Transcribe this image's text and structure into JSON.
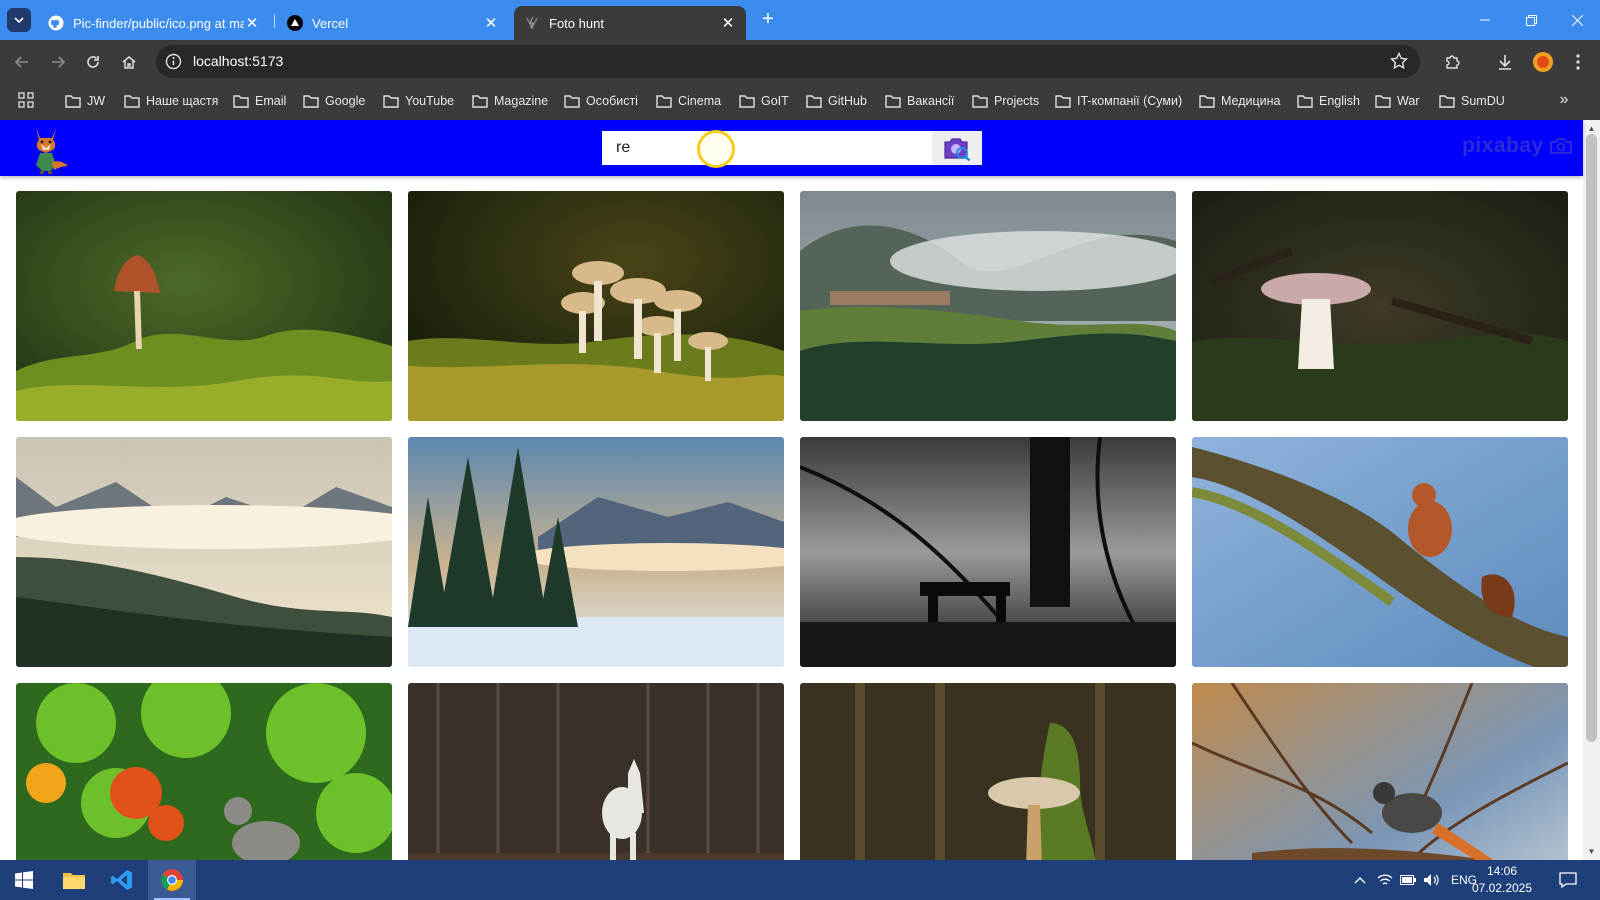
{
  "browser": {
    "tabs": [
      {
        "title": "Pic-finder/public/ico.png at ma",
        "icon": "github-icon",
        "close": "✕"
      },
      {
        "title": "Vercel",
        "icon": "vercel-icon",
        "close": "✕"
      },
      {
        "title": "Foto hunt",
        "icon": "vite-icon",
        "close": "✕",
        "active": true
      }
    ],
    "new_tab": "+",
    "url": "localhost:5173",
    "bookmarks": [
      "JW",
      "Наше щастя",
      "Email",
      "Google",
      "YouTube",
      "Magazine",
      "Особисті",
      "Cinema",
      "GoIT",
      "GitHub",
      "Вакансії",
      "Projects",
      "IT-компанії (Суми)",
      "Медицина",
      "English",
      "War",
      "SumDU"
    ],
    "more_bookmarks": "»"
  },
  "app": {
    "search": {
      "value": "re"
    },
    "brand": "pixabay",
    "images": [
      {
        "subject": "single brown mushroom on moss"
      },
      {
        "subject": "cluster of mushrooms in grass"
      },
      {
        "subject": "misty mountain village and forest"
      },
      {
        "subject": "white mushroom in dark forest"
      },
      {
        "subject": "foggy snowy mountain forest"
      },
      {
        "subject": "snowy fir trees at sunset"
      },
      {
        "subject": "black and white bench by lake"
      },
      {
        "subject": "red squirrel on tree branch"
      },
      {
        "subject": "squirrel among autumn maple leaves"
      },
      {
        "subject": "white horse in forest"
      },
      {
        "subject": "mushroom on mossy stump"
      },
      {
        "subject": "small bird on a twig"
      }
    ]
  },
  "taskbar": {
    "language": "ENG",
    "time": "14:06",
    "date": "07.02.2025"
  }
}
